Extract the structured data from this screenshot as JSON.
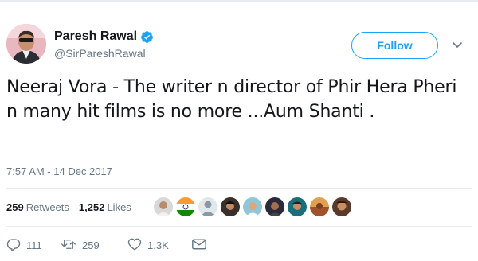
{
  "user": {
    "display_name": "Paresh Rawal",
    "handle": "@SirPareshRawal",
    "verified_icon": "verified-badge-icon",
    "avatar": "profile-photo"
  },
  "follow_label": "Follow",
  "tweet": {
    "text": "Neeraj Vora - The writer n director of Phir Hera Pheri n many hit films is no more  ...Aum Shanti .",
    "timestamp": "7:57 AM - 14 Dec 2017"
  },
  "stats": {
    "retweets_count": "259",
    "retweets_label": "Retweets",
    "likes_count": "1,252",
    "likes_label": "Likes"
  },
  "likers": [
    {
      "name": "liker-avatar-1",
      "color": "#d8d8d8"
    },
    {
      "name": "liker-avatar-2",
      "color": "#ff9933"
    },
    {
      "name": "liker-avatar-3",
      "color": "#8899a6"
    },
    {
      "name": "liker-avatar-4",
      "color": "#3b2f2a"
    },
    {
      "name": "liker-avatar-5",
      "color": "#8fc7d8"
    },
    {
      "name": "liker-avatar-6",
      "color": "#2a2a3a"
    },
    {
      "name": "liker-avatar-7",
      "color": "#1b6f7a"
    },
    {
      "name": "liker-avatar-8",
      "color": "#a0522d"
    },
    {
      "name": "liker-avatar-9",
      "color": "#c89060"
    }
  ],
  "actions": {
    "reply_count": "111",
    "retweet_count": "259",
    "like_count": "1.3K"
  },
  "colors": {
    "accent": "#1da1f2",
    "text": "#14171a",
    "secondary": "#657786"
  }
}
